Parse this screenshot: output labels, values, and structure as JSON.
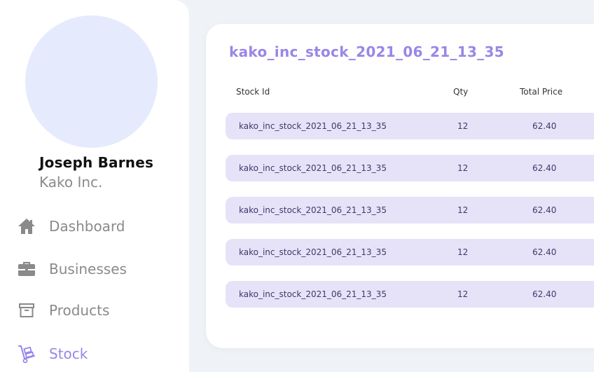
{
  "user": {
    "name": "Joseph Barnes",
    "company": "Kako Inc."
  },
  "nav": {
    "items": [
      {
        "label": "Dashboard",
        "icon": "home-icon"
      },
      {
        "label": "Businesses",
        "icon": "briefcase-icon"
      },
      {
        "label": "Products",
        "icon": "archive-box-icon"
      },
      {
        "label": "Stock",
        "icon": "hand-truck-icon",
        "active": true
      }
    ]
  },
  "stock": {
    "title": "kako_inc_stock_2021_06_21_13_35",
    "columns": [
      "Stock Id",
      "Qty",
      "Total Price"
    ],
    "rows": [
      {
        "id": "kako_inc_stock_2021_06_21_13_35",
        "qty": "12",
        "price": "62.40"
      },
      {
        "id": "kako_inc_stock_2021_06_21_13_35",
        "qty": "12",
        "price": "62.40"
      },
      {
        "id": "kako_inc_stock_2021_06_21_13_35",
        "qty": "12",
        "price": "62.40"
      },
      {
        "id": "kako_inc_stock_2021_06_21_13_35",
        "qty": "12",
        "price": "62.40"
      },
      {
        "id": "kako_inc_stock_2021_06_21_13_35",
        "qty": "12",
        "price": "62.40"
      }
    ]
  },
  "colors": {
    "accent": "#9a86e8",
    "row_bg": "#e6e2f8",
    "page_bg": "#eff2f6",
    "avatar_bg": "#e6eafd",
    "muted_text": "#8a8a8a"
  }
}
